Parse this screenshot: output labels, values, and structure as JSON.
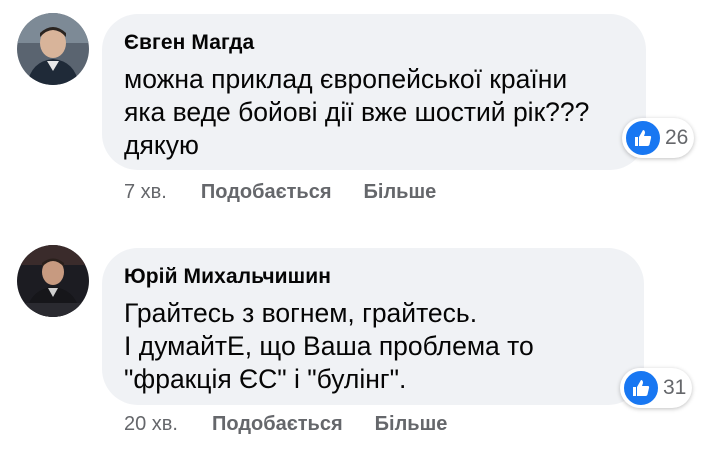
{
  "comments": [
    {
      "author": "Євген Магда",
      "lines": [
        "можна приклад європейської країни",
        "яка веде бойові дії вже шостий рік???",
        "дякую"
      ],
      "reaction_icon": "like-icon",
      "reaction_count": "26",
      "time": "7 хв.",
      "like_label": "Подобається",
      "more_label": "Більше"
    },
    {
      "author": "Юрій Михальчишин",
      "lines": [
        "Грайтесь з вогнем, грайтесь.",
        "І думайтЕ, що Ваша проблема то",
        "\"фракція ЄС\" і \"булінг\"."
      ],
      "reaction_icon": "like-icon",
      "reaction_count": "31",
      "time": "20 хв.",
      "like_label": "Подобається",
      "more_label": "Більше"
    }
  ],
  "colors": {
    "bubble": "#f0f2f5",
    "text": "#050505",
    "meta": "#65676b",
    "like_blue": "#1877f2"
  }
}
